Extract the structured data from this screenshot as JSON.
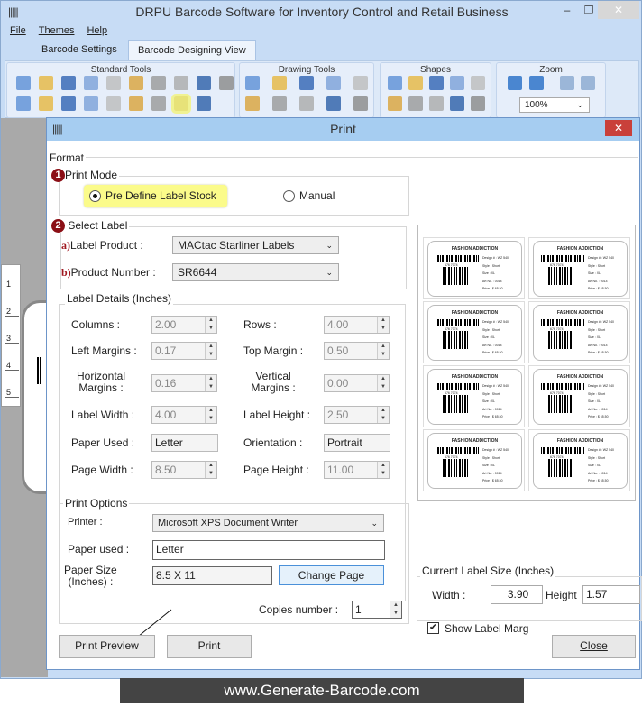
{
  "app": {
    "title": "DRPU Barcode Software for Inventory Control and Retail Business"
  },
  "menu": [
    "File",
    "Themes",
    "Help"
  ],
  "tabs": [
    {
      "label": "Barcode Settings",
      "active": false
    },
    {
      "label": "Barcode Designing View",
      "active": true
    }
  ],
  "ribbon": {
    "standard_tools": {
      "title": "Standard Tools",
      "icons": [
        "new-file",
        "open-folder",
        "save",
        "save-as",
        "copy",
        "paste",
        "cut",
        "delete",
        "undo",
        "redo",
        "send-back",
        "bring-front",
        "lock",
        "unlock",
        "grid",
        "database",
        "export-image",
        "print",
        "exit"
      ]
    },
    "drawing_tools": {
      "title": "Drawing Tools",
      "icons": [
        "text",
        "pen",
        "image",
        "barcode",
        "picture",
        "star-shape",
        "library",
        "watermark",
        "frame-dropdown",
        "shape-fill-dropdown"
      ]
    },
    "shapes": {
      "title": "Shapes",
      "icons": [
        "rectangle",
        "rounded-rectangle",
        "ellipse",
        "triangle",
        "diamond",
        "star",
        "line",
        "burst",
        "cross-star",
        "arc"
      ]
    },
    "zoom": {
      "title": "Zoom",
      "icons": [
        "actual-size",
        "fit-to-window",
        "zoom-in",
        "zoom-out"
      ],
      "value": "100%"
    }
  },
  "ruler": [
    "1",
    "2",
    "3",
    "4",
    "5"
  ],
  "dialog": {
    "title": "Print",
    "close": "✕",
    "format_label": "Format",
    "print_mode": {
      "num": "1",
      "label": "Print Mode",
      "options": [
        "Pre Define Label Stock",
        "Manual"
      ],
      "selected": "Pre Define Label Stock"
    },
    "select_label": {
      "num": "2",
      "label": "Select Label",
      "label_product": {
        "prefix": "a)",
        "label": "Label Product :",
        "value": "MACtac Starliner Labels"
      },
      "product_number": {
        "prefix": "b)",
        "label": "Product Number :",
        "value": "SR6644"
      }
    },
    "label_details": {
      "title": "Label Details (Inches)",
      "columns": {
        "label": "Columns :",
        "value": "2.00"
      },
      "rows": {
        "label": "Rows :",
        "value": "4.00"
      },
      "left_margins": {
        "label": "Left Margins :",
        "value": "0.17"
      },
      "top_margin": {
        "label": "Top Margin :",
        "value": "0.50"
      },
      "horizontal_margins": {
        "label1": "Horizontal",
        "label2": "Margins :",
        "value": "0.16"
      },
      "vertical_margins": {
        "label1": "Vertical",
        "label2": "Margins :",
        "value": "0.00"
      },
      "label_width": {
        "label": "Label Width :",
        "value": "4.00"
      },
      "label_height": {
        "label": "Label Height :",
        "value": "2.50"
      },
      "paper_used": {
        "label": "Paper Used :",
        "value": "Letter"
      },
      "orientation": {
        "label": "Orientation :",
        "value": "Portrait"
      },
      "page_width": {
        "label": "Page Width :",
        "value": "8.50"
      },
      "page_height": {
        "label": "Page Height :",
        "value": "11.00"
      }
    },
    "print_options": {
      "title": "Print Options",
      "printer": {
        "label": "Printer :",
        "value": "Microsoft XPS Document Writer"
      },
      "paper_used": {
        "label": "Paper used :",
        "value": "Letter"
      },
      "paper_size": {
        "label1": "Paper Size",
        "label2": "(Inches) :",
        "value": "8.5 X 11"
      },
      "change_page": "Change Page",
      "copies": {
        "label": "Copies number :",
        "value": "1"
      }
    },
    "preview_label": {
      "heading": "FASHION ADDICTION",
      "number": "676 7074",
      "lines": [
        "Design # : WZ 540",
        "Style : Short",
        "Size : XL",
        "Art No. : 0014",
        "Price : $ 65.50"
      ]
    },
    "current_label_size": {
      "title": "Current Label Size (Inches)",
      "width_label": "Width :",
      "width": "3.90",
      "height_label": "Height",
      "height": "1.57"
    },
    "show_label_margin": {
      "label": "Show Label Marg",
      "checked": true
    },
    "buttons": {
      "print_preview": "Print Preview",
      "print": "Print",
      "close": "Close"
    }
  },
  "banner": "www.Generate-Barcode.com",
  "colors": {
    "window_bg": "#c7dcf5",
    "dialog_title": "#a6cdf1",
    "close_red": "#c9403a",
    "highlight": "#fbfb8a",
    "step_badge": "#8b0f16"
  }
}
